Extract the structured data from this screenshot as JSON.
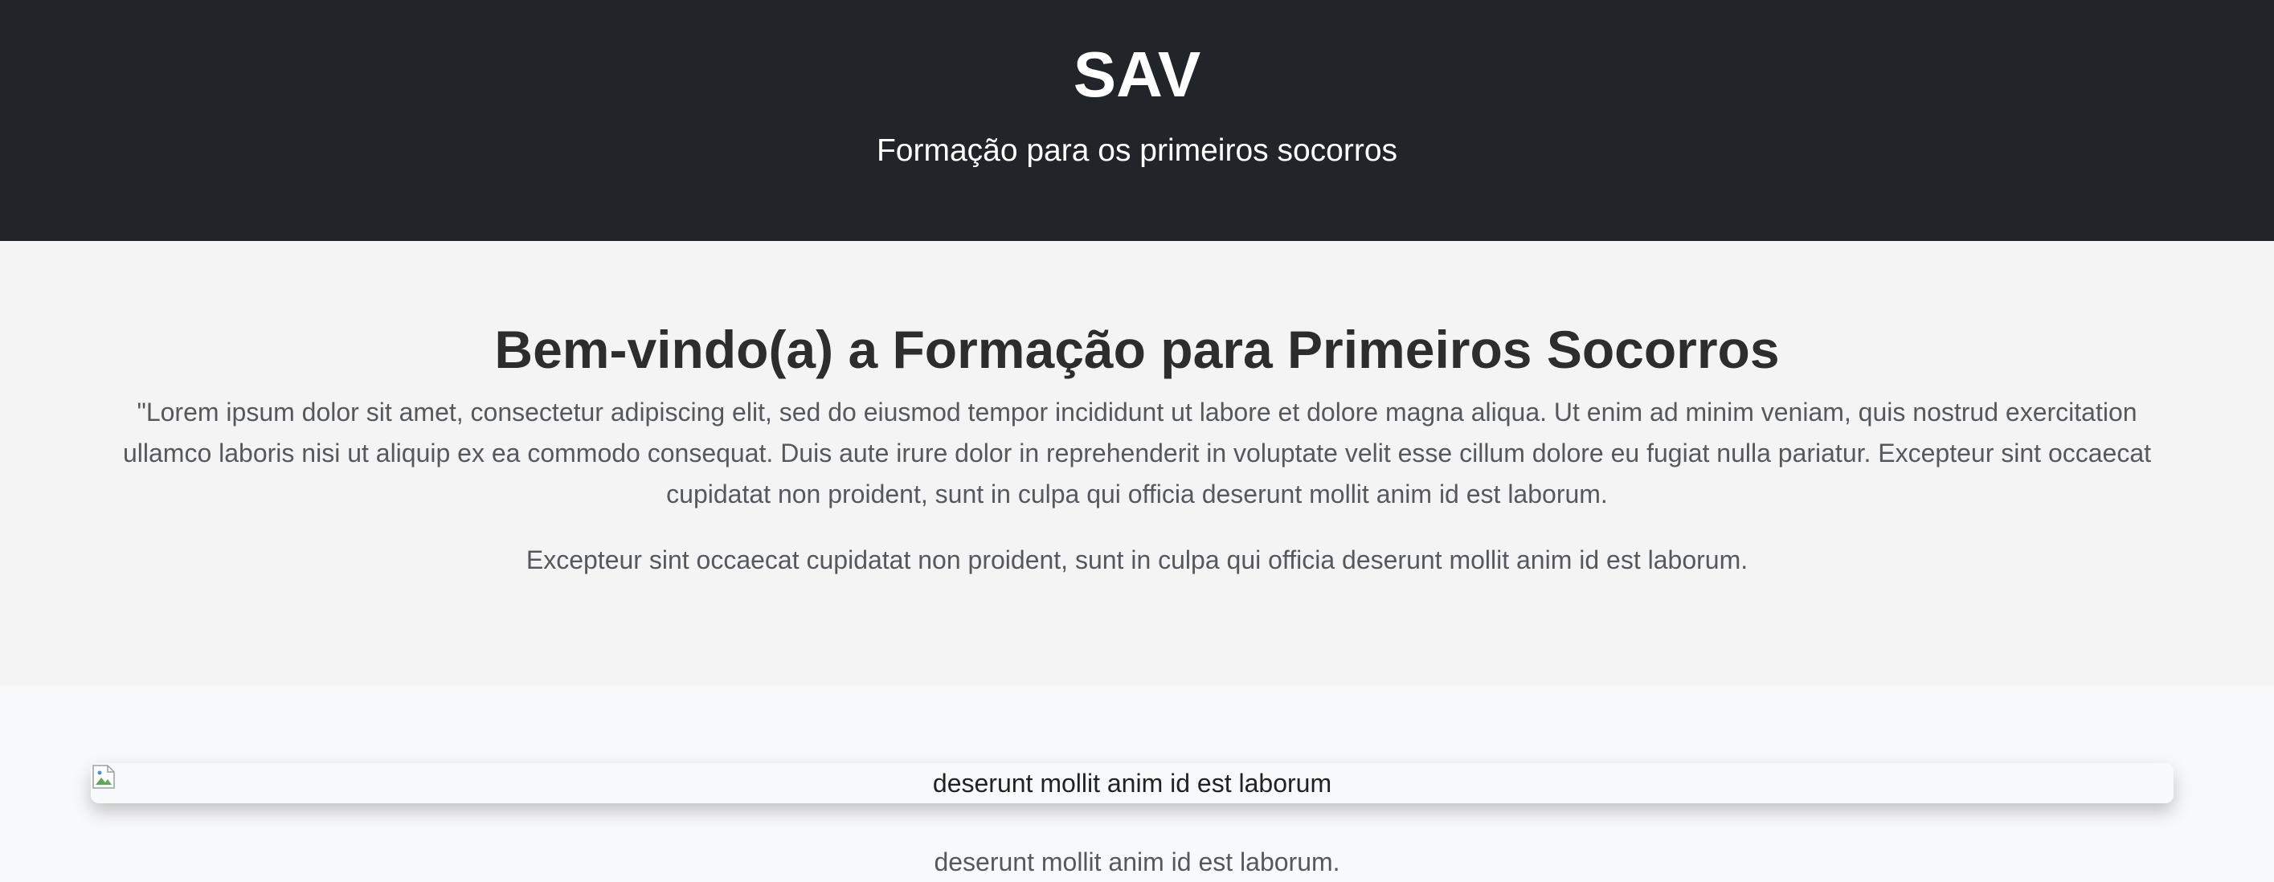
{
  "header": {
    "title": "SAV",
    "subtitle": "Formação para os primeiros socorros"
  },
  "welcome": {
    "title": "Bem-vindo(a) a Formação para Primeiros Socorros",
    "paragraph_1": "\"Lorem ipsum dolor sit amet, consectetur adipiscing elit, sed do eiusmod tempor incididunt ut labore et dolore magna aliqua. Ut enim ad minim veniam, quis nostrud exercitation ullamco laboris nisi ut aliquip ex ea commodo consequat. Duis aute irure dolor in reprehenderit in voluptate velit esse cillum dolore eu fugiat nulla pariatur. Excepteur sint occaecat cupidatat non proident, sunt in culpa qui officia deserunt mollit anim id est laborum.",
    "paragraph_2": "Excepteur sint occaecat cupidatat non proident, sunt in culpa qui officia deserunt mollit anim id est laborum."
  },
  "gallery": {
    "image_alt": "deserunt mollit anim id est laborum",
    "caption": "deserunt mollit anim id est laborum.",
    "icon": "broken-image-icon"
  },
  "colors": {
    "header_bg": "#212428",
    "welcome_bg": "#f4f4f4",
    "page_bg": "#f8f9fa"
  }
}
